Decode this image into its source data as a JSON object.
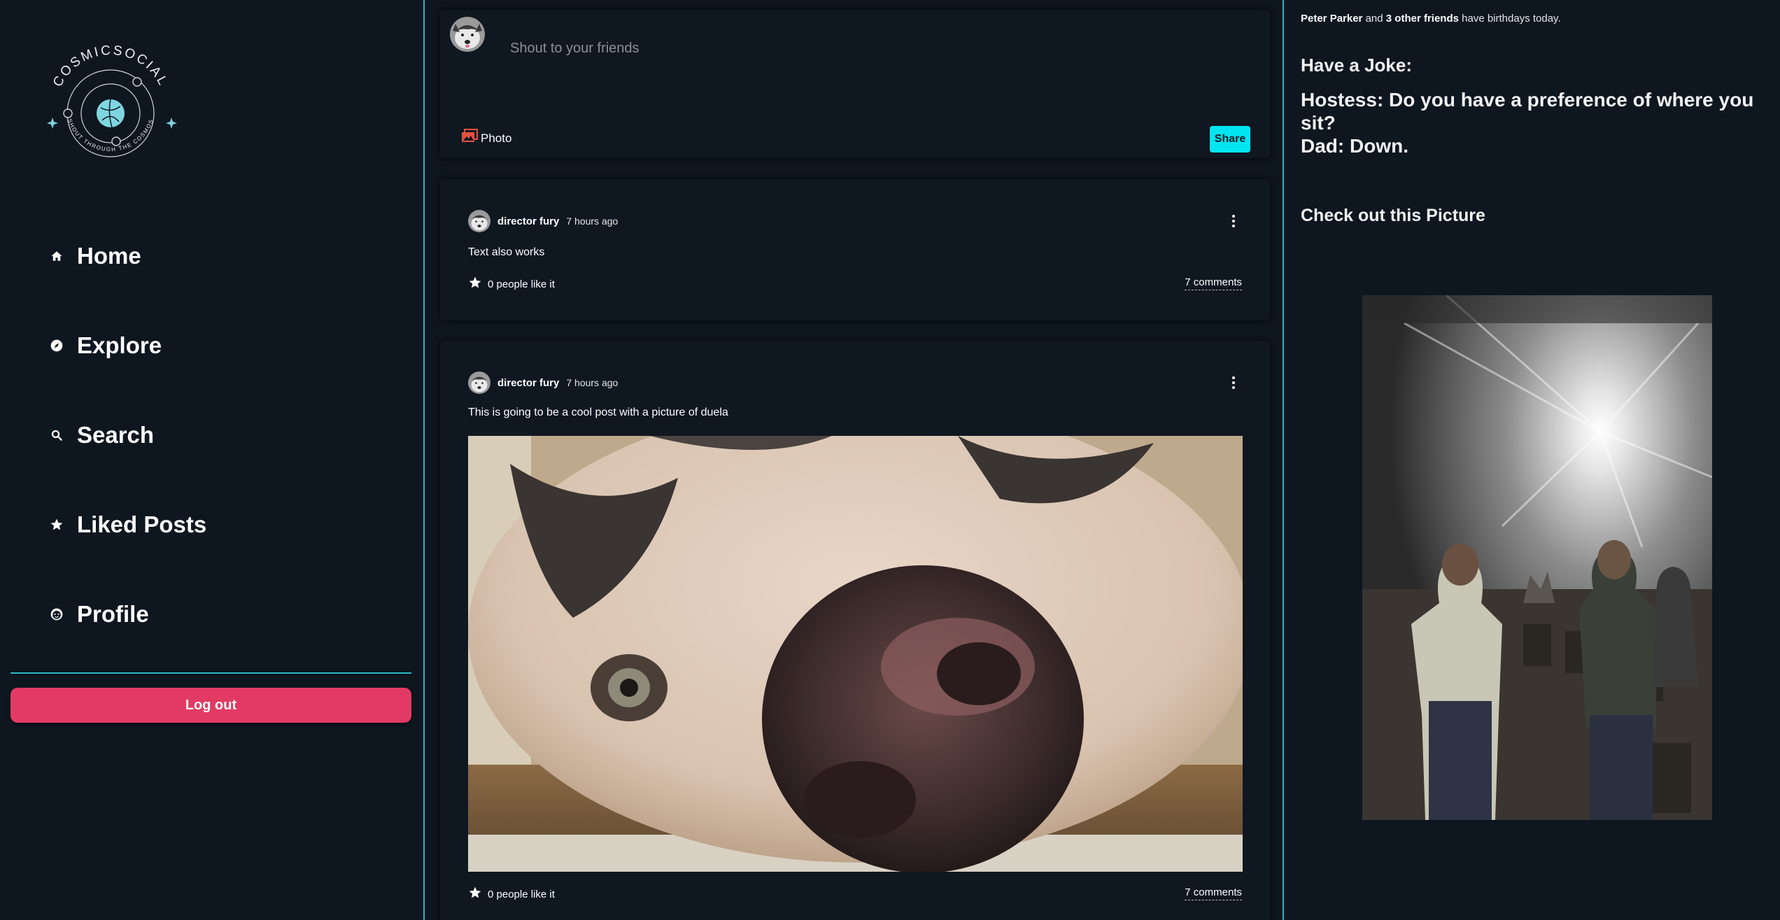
{
  "brand": {
    "name": "COSMICSOCIAL",
    "tagline": "SHOUT THROUGH THE COSMOS"
  },
  "sidebar": {
    "items": [
      {
        "label": "Home",
        "icon": "home-icon"
      },
      {
        "label": "Explore",
        "icon": "compass-icon"
      },
      {
        "label": "Search",
        "icon": "search-icon"
      },
      {
        "label": "Liked Posts",
        "icon": "star-icon"
      },
      {
        "label": "Profile",
        "icon": "face-icon"
      }
    ],
    "logout_label": "Log out"
  },
  "composer": {
    "placeholder": "Shout to your friends",
    "photo_label": "Photo",
    "share_label": "Share"
  },
  "posts": [
    {
      "author": "director fury",
      "time": "7 hours ago",
      "text": "Text also works",
      "likes": "0 people like it",
      "comments": "7 comments"
    },
    {
      "author": "director fury",
      "time": "7 hours ago",
      "text": "This is going to be a cool post with a picture of duela",
      "likes": "0 people like it",
      "comments": "7 comments"
    }
  ],
  "right": {
    "birthday": {
      "name": "Peter Parker",
      "and": "and",
      "friends": "3 other friends",
      "suffix": "have birthdays today."
    },
    "joke_title": "Have a Joke:",
    "joke_line1": "Hostess: Do you have a preference of where you sit?",
    "joke_line2": "Dad: Down.",
    "picture_title": "Check out this Picture"
  },
  "colors": {
    "background": "#0e1620",
    "accent": "#2bb8c4",
    "logout": "#e23a64",
    "share": "#00e5f0"
  }
}
